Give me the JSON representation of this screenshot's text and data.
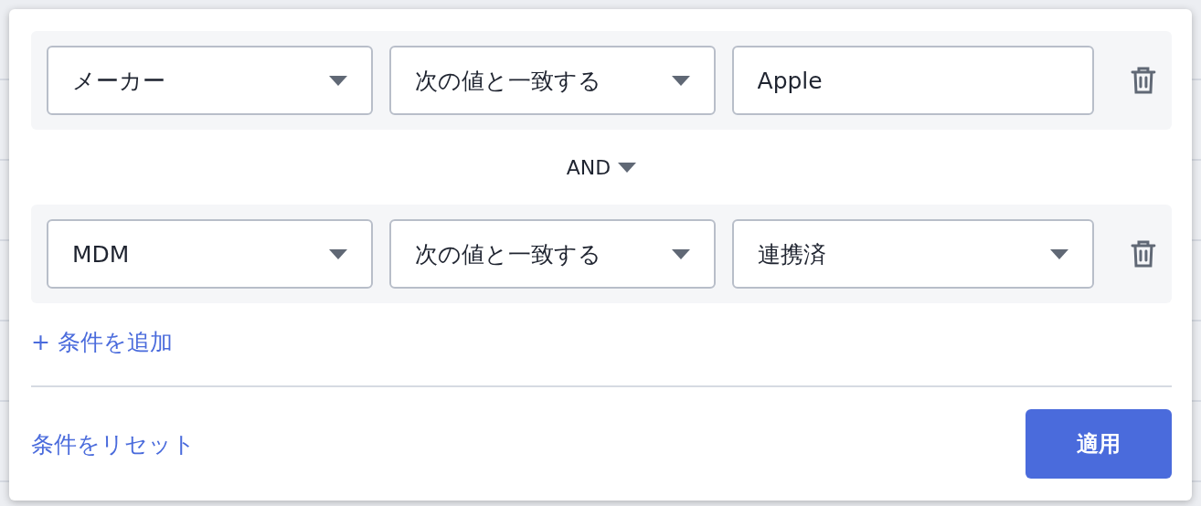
{
  "conditions": [
    {
      "fields": [
        {
          "kind": "select",
          "value": "メーカー"
        },
        {
          "kind": "select",
          "value": "次の値と一致する"
        },
        {
          "kind": "text",
          "value": "Apple"
        }
      ]
    },
    {
      "fields": [
        {
          "kind": "select",
          "value": "MDM"
        },
        {
          "kind": "select",
          "value": "次の値と一致する"
        },
        {
          "kind": "select",
          "value": "連携済"
        }
      ]
    }
  ],
  "joiner": "AND",
  "add_condition": "+ 条件を追加",
  "reset": "条件をリセット",
  "apply": "適用"
}
